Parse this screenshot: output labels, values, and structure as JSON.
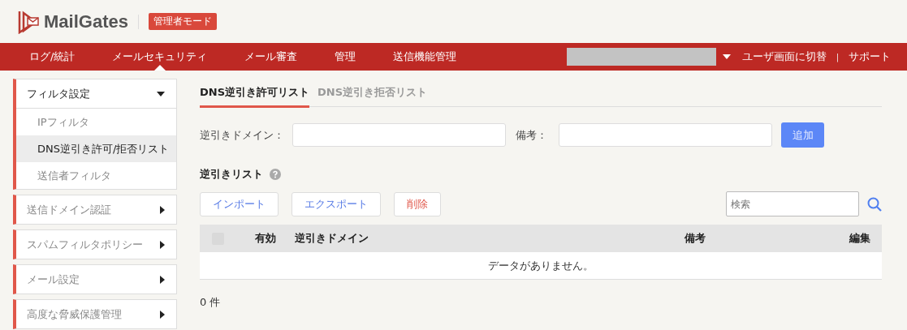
{
  "header": {
    "logo": "MailGates",
    "mode_badge": "管理者モード"
  },
  "nav": {
    "items": [
      {
        "label": "ログ/統計",
        "selected": false
      },
      {
        "label": "メールセキュリティ",
        "selected": true
      },
      {
        "label": "メール審査",
        "selected": false
      },
      {
        "label": "管理",
        "selected": false
      },
      {
        "label": "送信機能管理",
        "selected": false
      }
    ],
    "right_links": [
      "ユーザ画面に切替",
      "サポート"
    ],
    "separator": "|"
  },
  "sidebar": {
    "groups": [
      {
        "label": "フィルタ設定",
        "expanded": true,
        "children": [
          {
            "label": "IPフィルタ",
            "selected": false
          },
          {
            "label": "DNS逆引き許可/拒否リスト",
            "selected": true
          },
          {
            "label": "送信者フィルタ",
            "selected": false
          }
        ]
      },
      {
        "label": "送信ドメイン認証",
        "expanded": false
      },
      {
        "label": "スパムフィルタポリシー",
        "expanded": false
      },
      {
        "label": "メール設定",
        "expanded": false
      },
      {
        "label": "高度な脅威保護管理",
        "expanded": false
      }
    ]
  },
  "tabs": [
    {
      "label": "DNS逆引き許可リスト",
      "selected": true
    },
    {
      "label": "DNS逆引き拒否リスト",
      "selected": false
    }
  ],
  "form": {
    "domain_label": "逆引きドメイン：",
    "note_label": "備考：",
    "add_button": {
      "label": "追加",
      "disabled": true
    }
  },
  "list": {
    "title": "逆引きリスト",
    "buttons": [
      {
        "label": "インポート",
        "kind": "normal"
      },
      {
        "label": "エクスポート",
        "kind": "normal"
      },
      {
        "label": "削除",
        "kind": "danger"
      }
    ],
    "search": {
      "placeholder": "検索"
    },
    "table": {
      "select_all": {
        "disabled": true
      },
      "columns": [
        "有効",
        "逆引きドメイン",
        "備考",
        "編集"
      ],
      "empty_message": "データがありません。"
    },
    "count": "0 件"
  }
}
